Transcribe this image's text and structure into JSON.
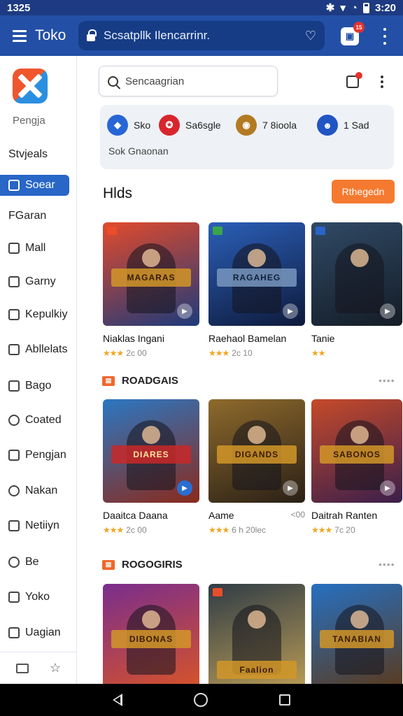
{
  "status_bar": {
    "time": "1325",
    "clock": "3:20",
    "icons": [
      "bluetooth-icon",
      "wifi-icon",
      "signal-icon",
      "battery-icon"
    ]
  },
  "app_bar": {
    "title": "Toko",
    "url": "Scsatpllk Ilencarrinr.",
    "tab_count": "15"
  },
  "sidebar": {
    "brand": "Pengja",
    "items": [
      {
        "label": "Stvjeals",
        "icon": "none"
      },
      {
        "label": "Soear",
        "icon": "grid-icon",
        "active": true
      },
      {
        "label": "FGaran",
        "icon": "none"
      },
      {
        "label": "Mall",
        "icon": "home-icon"
      },
      {
        "label": "Garny",
        "icon": "square-icon"
      },
      {
        "label": "Kepulkiy",
        "icon": "document-icon"
      },
      {
        "label": "Abllelats",
        "icon": "box-icon"
      },
      {
        "label": "Bago",
        "icon": "bag-icon"
      },
      {
        "label": "Coated",
        "icon": "tag-icon"
      },
      {
        "label": "Pengjan",
        "icon": "file-icon"
      },
      {
        "label": "Nakan",
        "icon": "search-icon"
      },
      {
        "label": "Netiiyn",
        "icon": "pen-icon"
      },
      {
        "label": "Be",
        "icon": "settings-icon"
      },
      {
        "label": "Yoko",
        "icon": "file-icon"
      },
      {
        "label": "Uagian",
        "icon": "bag-icon"
      }
    ]
  },
  "main": {
    "search_placeholder": "Sencaagrian",
    "categories": [
      {
        "label": "Sko",
        "color": "#2766d6"
      },
      {
        "label": "Sa6sgle",
        "color": "#d8262d"
      },
      {
        "label": "7 8ioola",
        "color": "#b37a22"
      },
      {
        "label": "1 Sad",
        "color": "#2255c4"
      }
    ],
    "categories_caption": "Sok Gnaonan",
    "section_title": "Hlds",
    "cta_label": "Rthegedn",
    "rows": [
      {
        "heading": "",
        "items": [
          {
            "name": "Niaklas Ingani",
            "rating": "2c 00",
            "stars": "★★★",
            "art": "MAGARAS",
            "c1": "#e24a2c",
            "c2": "#1d3a7a"
          },
          {
            "name": "Raehaol Bamelan",
            "rating": "2c 10",
            "stars": "★★★",
            "art": "RAGAHEG",
            "c1": "#2b5fb8",
            "c2": "#0e1a3b"
          },
          {
            "name": "Tanie",
            "rating": "",
            "stars": "★★",
            "art": "",
            "c1": "#304a66",
            "c2": "#141c26"
          }
        ]
      },
      {
        "heading": "ROADGAIS",
        "items": [
          {
            "name": "Daaitca Daana",
            "rating": "2c 00",
            "stars": "★★★",
            "art": "DIARES",
            "c1": "#2b77c2",
            "c2": "#8a2a1c"
          },
          {
            "name": "Aame",
            "rating": "6 h 20lec",
            "stars": "★★★",
            "art": "DIGANDS",
            "c1": "#8e6a2c",
            "c2": "#2a2016"
          },
          {
            "name": "Daitrah Ranten",
            "rating": "7c 20",
            "stars": "★★★",
            "art": "SABONOS",
            "c1": "#c54a2a",
            "c2": "#3b1f4b"
          }
        ]
      },
      {
        "heading": "ROGOGIRIS",
        "items": [
          {
            "name": "",
            "rating": "",
            "stars": "",
            "art": "DIBONAS",
            "c1": "#7a2d8e",
            "c2": "#d6532a"
          },
          {
            "name": "",
            "rating": "",
            "stars": "",
            "art": "Faalion",
            "c1": "#2f3c46",
            "c2": "#b89a55"
          },
          {
            "name": "",
            "rating": "",
            "stars": "",
            "art": "TANABIAN",
            "c1": "#2670c2",
            "c2": "#5a3a1e"
          }
        ]
      }
    ],
    "row_extra": "<00"
  }
}
